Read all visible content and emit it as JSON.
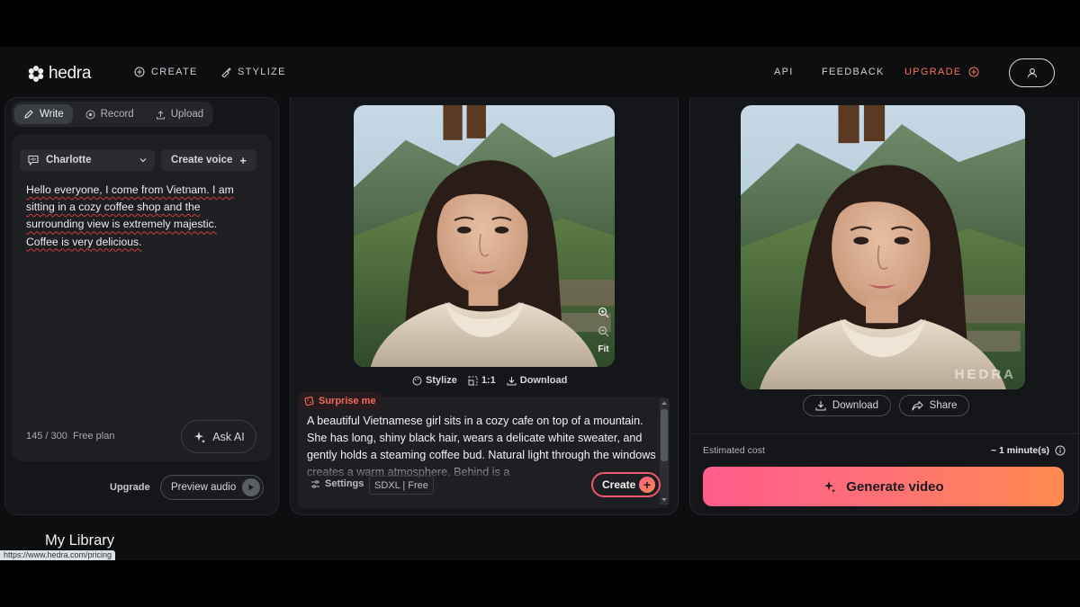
{
  "brand": {
    "name": "hedra"
  },
  "nav": {
    "create": "CREATE",
    "stylize": "STYLIZE",
    "api": "API",
    "feedback": "FEEDBACK",
    "upgrade": "UPGRADE"
  },
  "audio_panel": {
    "tabs": [
      "Write",
      "Record",
      "Upload"
    ],
    "active_tab": "Write",
    "voice": "Charlotte",
    "create_voice": "Create voice",
    "script": "Hello everyone, I come from Vietnam. I am sitting in a cozy coffee shop and the surrounding view is extremely majestic. Coffee is very delicious.",
    "char_count": "145 / 300",
    "plan": "Free plan",
    "ask_ai": "Ask AI",
    "upgrade": "Upgrade",
    "preview_audio": "Preview audio"
  },
  "image_panel": {
    "fit": "Fit",
    "stylize": "Stylize",
    "ratio": "1:1",
    "download": "Download",
    "surprise_me": "Surprise me",
    "prompt": "A beautiful Vietnamese girl sits in a cozy cafe on top of a mountain. She has long, shiny black hair, wears a delicate white sweater, and gently holds a steaming coffee bud. Natural light through the windows creates a warm atmosphere. Behind is a",
    "settings": "Settings",
    "model": "SDXL | Free",
    "create": "Create"
  },
  "video_panel": {
    "watermark": "HEDRA",
    "download": "Download",
    "share": "Share",
    "estimated_cost_label": "Estimated cost",
    "estimated_time": "~ 1 minute(s)",
    "generate": "Generate video"
  },
  "library_title": "My Library",
  "status_url": "https://www.hedra.com/pricing",
  "colors": {
    "accent_orange": "#f2715c",
    "gradient_start": "#ff5c8a",
    "gradient_end": "#ff8a4e",
    "panel_bg": "#15161a"
  }
}
